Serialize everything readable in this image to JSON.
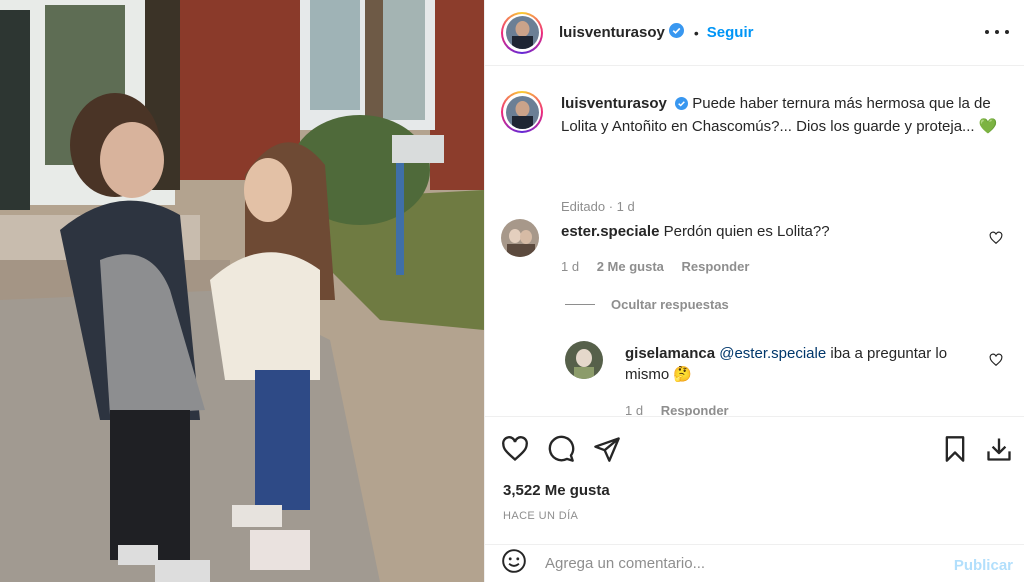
{
  "post": {
    "username": "luisventurasoy",
    "separator": "•",
    "follow_label": "Seguir"
  },
  "caption": {
    "username": "luisventurasoy",
    "text": "Puede haber ternura más hermosa que la de Lolita y Antoñito en Chascomús?... Dios los guarde y proteja...",
    "emoji": "💚",
    "meta": "Editado · 1 d"
  },
  "comments": [
    {
      "username": "ester.speciale",
      "text": "Perdón quien es Lolita??",
      "time": "1 d",
      "likes": "2 Me gusta",
      "reply_label": "Responder"
    }
  ],
  "replies_toggle": "Ocultar respuestas",
  "replies": [
    {
      "username": "giselamanca",
      "mention": "@ester.speciale",
      "text": "iba a preguntar lo mismo",
      "emoji": "🤔",
      "time": "1 d",
      "reply_label": "Responder"
    }
  ],
  "likes_count": "3,522 Me gusta",
  "date": "HACE UN DÍA",
  "add_comment": {
    "placeholder": "Agrega un comentario...",
    "publish_label": "Publicar"
  },
  "icons": {
    "verified": "verified-badge-icon",
    "more": "more-options-icon",
    "like": "heart-icon",
    "comment": "comment-icon",
    "share": "send-icon",
    "save": "bookmark-icon",
    "download": "download-icon",
    "emoji": "emoji-icon"
  },
  "colors": {
    "accent": "#0095f6",
    "text": "#262626",
    "muted": "#8e8e8e",
    "publish_disabled": "#b2dffc"
  }
}
